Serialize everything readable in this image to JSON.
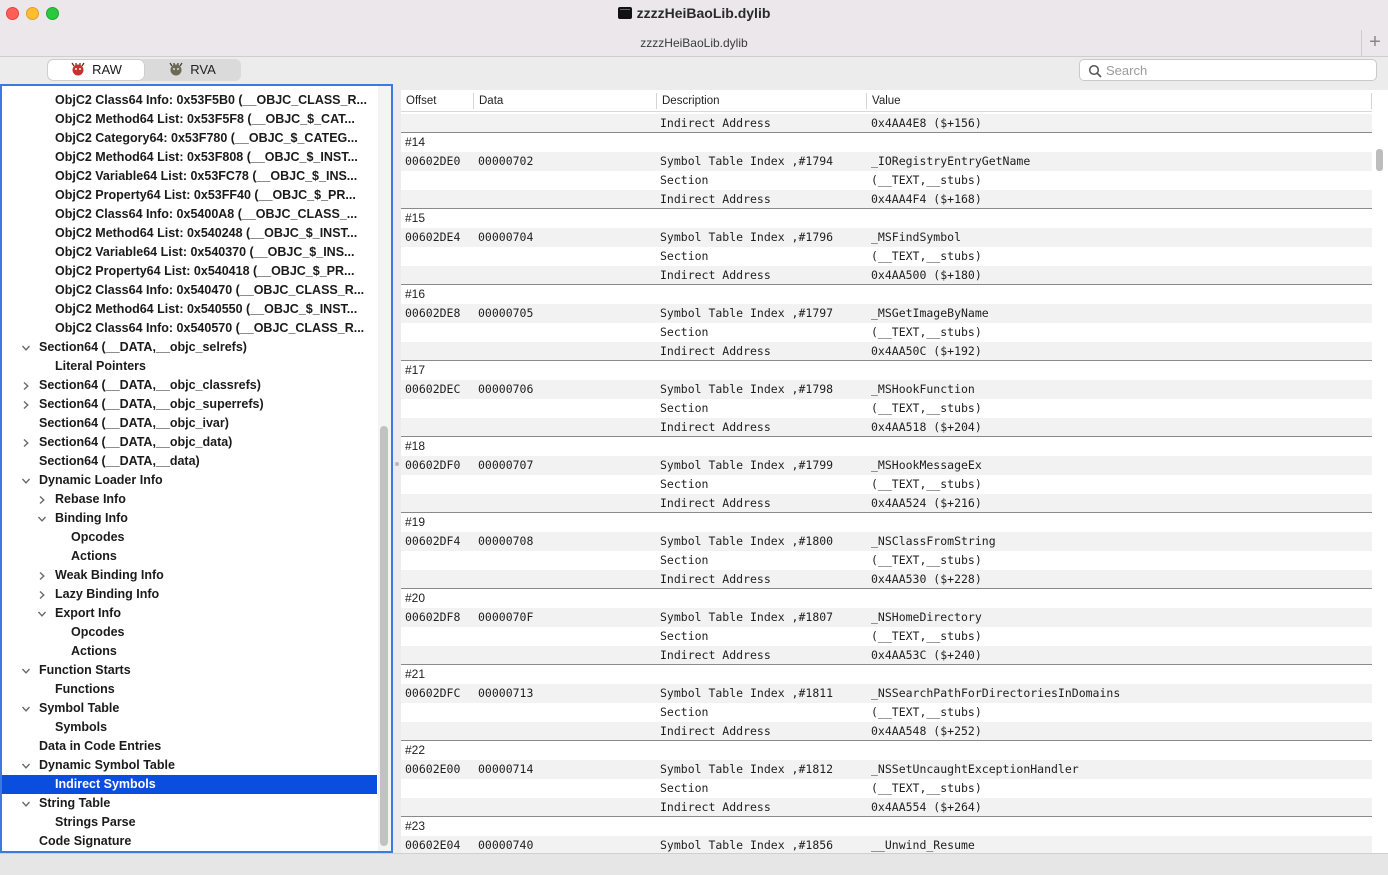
{
  "window": {
    "title": "zzzzHeiBaoLib.dylib",
    "subtitle": "zzzzHeiBaoLib.dylib",
    "add_tab": "+"
  },
  "toolbar": {
    "raw_label": "RAW",
    "rva_label": "RVA",
    "search_placeholder": "Search"
  },
  "tree": [
    {
      "label": "ObjC2 Class64 Info: 0x53F5B0 (__OBJC_CLASS_R...",
      "depth": 2,
      "chevron": "none"
    },
    {
      "label": "ObjC2 Method64 List: 0x53F5F8 (__OBJC_$_CAT...",
      "depth": 2,
      "chevron": "none"
    },
    {
      "label": "ObjC2 Category64: 0x53F780 (__OBJC_$_CATEG...",
      "depth": 2,
      "chevron": "none"
    },
    {
      "label": "ObjC2 Method64 List: 0x53F808 (__OBJC_$_INST...",
      "depth": 2,
      "chevron": "none"
    },
    {
      "label": "ObjC2 Variable64 List: 0x53FC78 (__OBJC_$_INS...",
      "depth": 2,
      "chevron": "none"
    },
    {
      "label": "ObjC2 Property64 List: 0x53FF40 (__OBJC_$_PR...",
      "depth": 2,
      "chevron": "none"
    },
    {
      "label": "ObjC2 Class64 Info: 0x5400A8 (__OBJC_CLASS_...",
      "depth": 2,
      "chevron": "none"
    },
    {
      "label": "ObjC2 Method64 List: 0x540248 (__OBJC_$_INST...",
      "depth": 2,
      "chevron": "none"
    },
    {
      "label": "ObjC2 Variable64 List: 0x540370 (__OBJC_$_INS...",
      "depth": 2,
      "chevron": "none"
    },
    {
      "label": "ObjC2 Property64 List: 0x540418 (__OBJC_$_PR...",
      "depth": 2,
      "chevron": "none"
    },
    {
      "label": "ObjC2 Class64 Info: 0x540470 (__OBJC_CLASS_R...",
      "depth": 2,
      "chevron": "none"
    },
    {
      "label": "ObjC2 Method64 List: 0x540550 (__OBJC_$_INST...",
      "depth": 2,
      "chevron": "none"
    },
    {
      "label": "ObjC2 Class64 Info: 0x540570 (__OBJC_CLASS_R...",
      "depth": 2,
      "chevron": "none"
    },
    {
      "label": "Section64 (__DATA,__objc_selrefs)",
      "depth": 1,
      "chevron": "down"
    },
    {
      "label": "Literal Pointers",
      "depth": 2,
      "chevron": "none"
    },
    {
      "label": "Section64 (__DATA,__objc_classrefs)",
      "depth": 1,
      "chevron": "right"
    },
    {
      "label": "Section64 (__DATA,__objc_superrefs)",
      "depth": 1,
      "chevron": "right"
    },
    {
      "label": "Section64 (__DATA,__objc_ivar)",
      "depth": 1,
      "chevron": "none"
    },
    {
      "label": "Section64 (__DATA,__objc_data)",
      "depth": 1,
      "chevron": "right"
    },
    {
      "label": "Section64 (__DATA,__data)",
      "depth": 1,
      "chevron": "none"
    },
    {
      "label": "Dynamic Loader Info",
      "depth": 1,
      "chevron": "down"
    },
    {
      "label": "Rebase Info",
      "depth": 2,
      "chevron": "right"
    },
    {
      "label": "Binding Info",
      "depth": 2,
      "chevron": "down"
    },
    {
      "label": "Opcodes",
      "depth": 3,
      "chevron": "none"
    },
    {
      "label": "Actions",
      "depth": 3,
      "chevron": "none"
    },
    {
      "label": "Weak Binding Info",
      "depth": 2,
      "chevron": "right"
    },
    {
      "label": "Lazy Binding Info",
      "depth": 2,
      "chevron": "right"
    },
    {
      "label": "Export Info",
      "depth": 2,
      "chevron": "down"
    },
    {
      "label": "Opcodes",
      "depth": 3,
      "chevron": "none"
    },
    {
      "label": "Actions",
      "depth": 3,
      "chevron": "none"
    },
    {
      "label": "Function Starts",
      "depth": 1,
      "chevron": "down"
    },
    {
      "label": "Functions",
      "depth": 2,
      "chevron": "none"
    },
    {
      "label": "Symbol Table",
      "depth": 1,
      "chevron": "down"
    },
    {
      "label": "Symbols",
      "depth": 2,
      "chevron": "none"
    },
    {
      "label": "Data in Code Entries",
      "depth": 1,
      "chevron": "none"
    },
    {
      "label": "Dynamic Symbol Table",
      "depth": 1,
      "chevron": "down"
    },
    {
      "label": "Indirect Symbols",
      "depth": 2,
      "chevron": "none",
      "selected": true
    },
    {
      "label": "String Table",
      "depth": 1,
      "chevron": "down"
    },
    {
      "label": "Strings Parse",
      "depth": 2,
      "chevron": "none"
    },
    {
      "label": "Code Signature",
      "depth": 1,
      "chevron": "none"
    }
  ],
  "table": {
    "columns": [
      "Offset",
      "Data",
      "Description",
      "Value"
    ],
    "rows": [
      {
        "type": "row",
        "offset": "",
        "data": "",
        "desc": "Indirect Address",
        "value": "0x4AA4E8 ($+156)",
        "alt": true,
        "end": true
      },
      {
        "type": "group",
        "label": "#14"
      },
      {
        "type": "row",
        "offset": "00602DE0",
        "data": "00000702",
        "desc": "Symbol Table Index ,#1794",
        "value": "_IORegistryEntryGetName",
        "alt": true
      },
      {
        "type": "row",
        "offset": "",
        "data": "",
        "desc": "Section",
        "value": "(__TEXT,__stubs)"
      },
      {
        "type": "row",
        "offset": "",
        "data": "",
        "desc": "Indirect Address",
        "value": "0x4AA4F4 ($+168)",
        "alt": true,
        "end": true
      },
      {
        "type": "group",
        "label": "#15"
      },
      {
        "type": "row",
        "offset": "00602DE4",
        "data": "00000704",
        "desc": "Symbol Table Index ,#1796",
        "value": "_MSFindSymbol",
        "alt": true
      },
      {
        "type": "row",
        "offset": "",
        "data": "",
        "desc": "Section",
        "value": "(__TEXT,__stubs)"
      },
      {
        "type": "row",
        "offset": "",
        "data": "",
        "desc": "Indirect Address",
        "value": "0x4AA500 ($+180)",
        "alt": true,
        "end": true
      },
      {
        "type": "group",
        "label": "#16"
      },
      {
        "type": "row",
        "offset": "00602DE8",
        "data": "00000705",
        "desc": "Symbol Table Index ,#1797",
        "value": "_MSGetImageByName",
        "alt": true
      },
      {
        "type": "row",
        "offset": "",
        "data": "",
        "desc": "Section",
        "value": "(__TEXT,__stubs)"
      },
      {
        "type": "row",
        "offset": "",
        "data": "",
        "desc": "Indirect Address",
        "value": "0x4AA50C ($+192)",
        "alt": true,
        "end": true
      },
      {
        "type": "group",
        "label": "#17"
      },
      {
        "type": "row",
        "offset": "00602DEC",
        "data": "00000706",
        "desc": "Symbol Table Index ,#1798",
        "value": "_MSHookFunction",
        "alt": true
      },
      {
        "type": "row",
        "offset": "",
        "data": "",
        "desc": "Section",
        "value": "(__TEXT,__stubs)"
      },
      {
        "type": "row",
        "offset": "",
        "data": "",
        "desc": "Indirect Address",
        "value": "0x4AA518 ($+204)",
        "alt": true,
        "end": true
      },
      {
        "type": "group",
        "label": "#18"
      },
      {
        "type": "row",
        "offset": "00602DF0",
        "data": "00000707",
        "desc": "Symbol Table Index ,#1799",
        "value": "_MSHookMessageEx",
        "alt": true
      },
      {
        "type": "row",
        "offset": "",
        "data": "",
        "desc": "Section",
        "value": "(__TEXT,__stubs)"
      },
      {
        "type": "row",
        "offset": "",
        "data": "",
        "desc": "Indirect Address",
        "value": "0x4AA524 ($+216)",
        "alt": true,
        "end": true
      },
      {
        "type": "group",
        "label": "#19"
      },
      {
        "type": "row",
        "offset": "00602DF4",
        "data": "00000708",
        "desc": "Symbol Table Index ,#1800",
        "value": "_NSClassFromString",
        "alt": true
      },
      {
        "type": "row",
        "offset": "",
        "data": "",
        "desc": "Section",
        "value": "(__TEXT,__stubs)"
      },
      {
        "type": "row",
        "offset": "",
        "data": "",
        "desc": "Indirect Address",
        "value": "0x4AA530 ($+228)",
        "alt": true,
        "end": true
      },
      {
        "type": "group",
        "label": "#20"
      },
      {
        "type": "row",
        "offset": "00602DF8",
        "data": "0000070F",
        "desc": "Symbol Table Index ,#1807",
        "value": "_NSHomeDirectory",
        "alt": true
      },
      {
        "type": "row",
        "offset": "",
        "data": "",
        "desc": "Section",
        "value": "(__TEXT,__stubs)"
      },
      {
        "type": "row",
        "offset": "",
        "data": "",
        "desc": "Indirect Address",
        "value": "0x4AA53C ($+240)",
        "alt": true,
        "end": true
      },
      {
        "type": "group",
        "label": "#21"
      },
      {
        "type": "row",
        "offset": "00602DFC",
        "data": "00000713",
        "desc": "Symbol Table Index ,#1811",
        "value": "_NSSearchPathForDirectoriesInDomains",
        "alt": true
      },
      {
        "type": "row",
        "offset": "",
        "data": "",
        "desc": "Section",
        "value": "(__TEXT,__stubs)"
      },
      {
        "type": "row",
        "offset": "",
        "data": "",
        "desc": "Indirect Address",
        "value": "0x4AA548 ($+252)",
        "alt": true,
        "end": true
      },
      {
        "type": "group",
        "label": "#22"
      },
      {
        "type": "row",
        "offset": "00602E00",
        "data": "00000714",
        "desc": "Symbol Table Index ,#1812",
        "value": "_NSSetUncaughtExceptionHandler",
        "alt": true
      },
      {
        "type": "row",
        "offset": "",
        "data": "",
        "desc": "Section",
        "value": "(__TEXT,__stubs)"
      },
      {
        "type": "row",
        "offset": "",
        "data": "",
        "desc": "Indirect Address",
        "value": "0x4AA554 ($+264)",
        "alt": true,
        "end": true
      },
      {
        "type": "group",
        "label": "#23"
      },
      {
        "type": "row",
        "offset": "00602E04",
        "data": "00000740",
        "desc": "Symbol Table Index ,#1856",
        "value": "__Unwind_Resume",
        "alt": true
      }
    ]
  },
  "colors": {
    "selection": "#0a4ee0",
    "focus_ring": "#3a7bde"
  }
}
